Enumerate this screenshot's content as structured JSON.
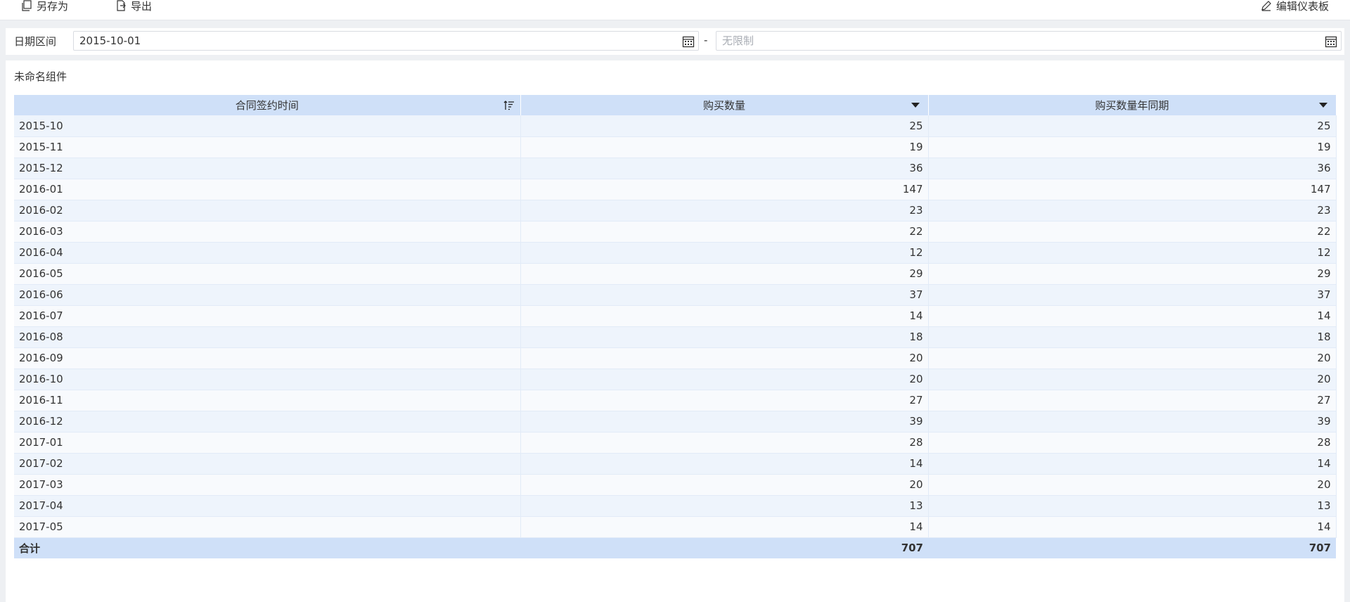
{
  "toolbar": {
    "save_as": "另存为",
    "export": "导出",
    "edit_dashboard": "编辑仪表板"
  },
  "filter": {
    "label": "日期区间",
    "start_value": "2015-10-01",
    "separator": "-",
    "end_placeholder": "无限制"
  },
  "widget": {
    "title": "未命名组件",
    "columns": [
      "合同签约时间",
      "购买数量",
      "购买数量年同期"
    ],
    "rows": [
      [
        "2015-10",
        "25",
        "25"
      ],
      [
        "2015-11",
        "19",
        "19"
      ],
      [
        "2015-12",
        "36",
        "36"
      ],
      [
        "2016-01",
        "147",
        "147"
      ],
      [
        "2016-02",
        "23",
        "23"
      ],
      [
        "2016-03",
        "22",
        "22"
      ],
      [
        "2016-04",
        "12",
        "12"
      ],
      [
        "2016-05",
        "29",
        "29"
      ],
      [
        "2016-06",
        "37",
        "37"
      ],
      [
        "2016-07",
        "14",
        "14"
      ],
      [
        "2016-08",
        "18",
        "18"
      ],
      [
        "2016-09",
        "20",
        "20"
      ],
      [
        "2016-10",
        "20",
        "20"
      ],
      [
        "2016-11",
        "27",
        "27"
      ],
      [
        "2016-12",
        "39",
        "39"
      ],
      [
        "2017-01",
        "28",
        "28"
      ],
      [
        "2017-02",
        "14",
        "14"
      ],
      [
        "2017-03",
        "20",
        "20"
      ],
      [
        "2017-04",
        "13",
        "13"
      ],
      [
        "2017-05",
        "14",
        "14"
      ]
    ],
    "total": [
      "合计",
      "707",
      "707"
    ]
  },
  "icons": {
    "save": "copy-icon",
    "export": "export-file-icon",
    "edit": "pencil-icon",
    "calendar": "calendar-icon",
    "sort": "sort-ascending-icon",
    "dropdown": "triangle-down-icon"
  },
  "colors": {
    "header_bg": "#cfe0f8",
    "row_odd": "#eef4fc",
    "row_even": "#f8fafd",
    "page_bg": "#eef0f3"
  }
}
